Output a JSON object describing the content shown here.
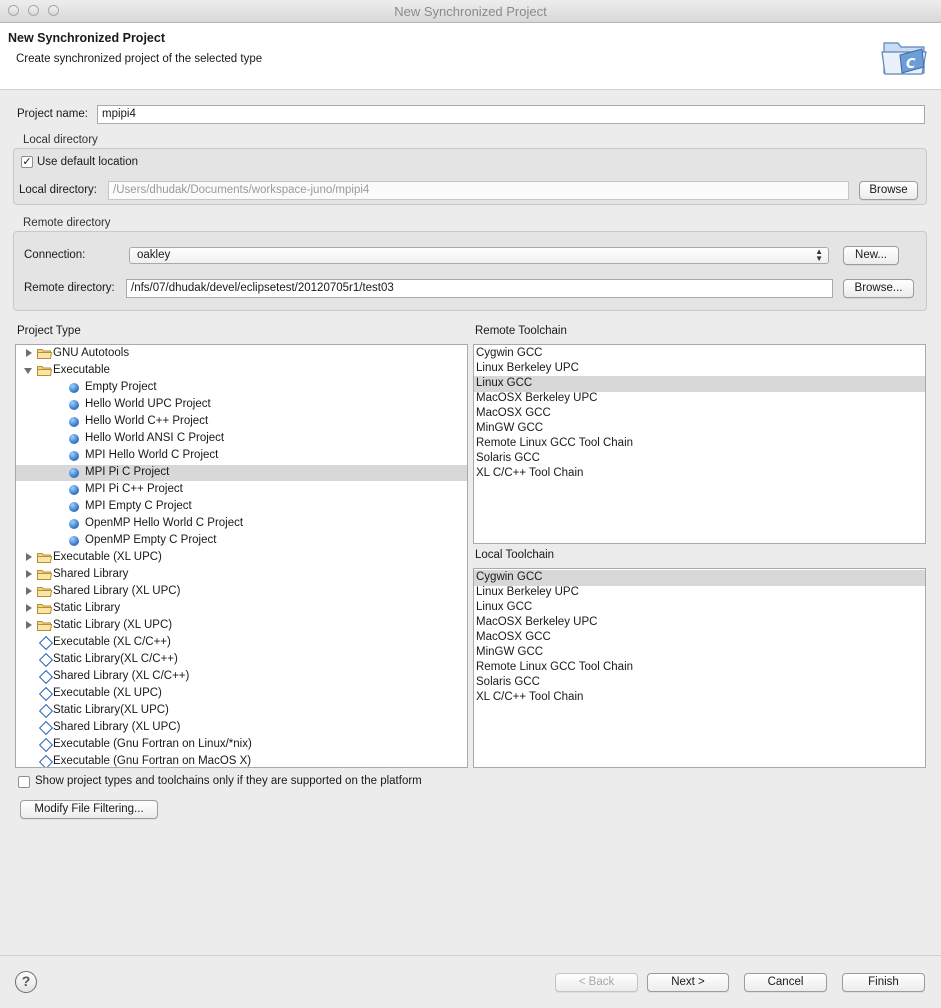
{
  "window": {
    "title": "New Synchronized Project"
  },
  "header": {
    "title": "New Synchronized Project",
    "description": "Create synchronized project of the selected type",
    "icon": "c-project-folder-icon"
  },
  "project_name": {
    "label": "Project name:",
    "value": "mpipi4"
  },
  "local_directory": {
    "group_label": "Local directory",
    "use_default_label": "Use default location",
    "use_default_checked": true,
    "field_label": "Local directory:",
    "value": "/Users/dhudak/Documents/workspace-juno/mpipi4",
    "browse_label": "Browse"
  },
  "remote_directory": {
    "group_label": "Remote directory",
    "connection_label": "Connection:",
    "connection_value": "oakley",
    "new_label": "New...",
    "field_label": "Remote directory:",
    "value": "/nfs/07/dhudak/devel/eclipsetest/20120705r1/test03",
    "browse_label": "Browse..."
  },
  "project_type": {
    "label": "Project Type",
    "items": [
      {
        "label": "GNU Autotools",
        "kind": "folder",
        "expander": "closed",
        "indent": 0
      },
      {
        "label": "Executable",
        "kind": "folder",
        "expander": "open",
        "indent": 0
      },
      {
        "label": "Empty Project",
        "kind": "dot",
        "indent": 1
      },
      {
        "label": "Hello World UPC Project",
        "kind": "dot",
        "indent": 1
      },
      {
        "label": "Hello World C++ Project",
        "kind": "dot",
        "indent": 1
      },
      {
        "label": "Hello World ANSI C Project",
        "kind": "dot",
        "indent": 1
      },
      {
        "label": "MPI Hello World C Project",
        "kind": "dot",
        "indent": 1
      },
      {
        "label": "MPI Pi C Project",
        "kind": "dot",
        "indent": 1,
        "selected": true
      },
      {
        "label": "MPI Pi C++ Project",
        "kind": "dot",
        "indent": 1
      },
      {
        "label": "MPI Empty C Project",
        "kind": "dot",
        "indent": 1
      },
      {
        "label": "OpenMP Hello World C Project",
        "kind": "dot",
        "indent": 1
      },
      {
        "label": "OpenMP Empty C Project",
        "kind": "dot",
        "indent": 1
      },
      {
        "label": "Executable (XL UPC)",
        "kind": "folder",
        "expander": "closed",
        "indent": 0
      },
      {
        "label": "Shared Library",
        "kind": "folder",
        "expander": "closed",
        "indent": 0
      },
      {
        "label": "Shared Library (XL UPC)",
        "kind": "folder",
        "expander": "closed",
        "indent": 0
      },
      {
        "label": "Static Library",
        "kind": "folder",
        "expander": "closed",
        "indent": 0
      },
      {
        "label": "Static Library (XL UPC)",
        "kind": "folder",
        "expander": "closed",
        "indent": 0
      },
      {
        "label": "Executable (XL C/C++)",
        "kind": "diamond",
        "indent": 0
      },
      {
        "label": "Static Library(XL C/C++)",
        "kind": "diamond",
        "indent": 0
      },
      {
        "label": "Shared Library (XL C/C++)",
        "kind": "diamond",
        "indent": 0
      },
      {
        "label": "Executable (XL UPC)",
        "kind": "diamond",
        "indent": 0
      },
      {
        "label": "Static Library(XL UPC)",
        "kind": "diamond",
        "indent": 0
      },
      {
        "label": "Shared Library (XL UPC)",
        "kind": "diamond",
        "indent": 0
      },
      {
        "label": "Executable (Gnu Fortran on Linux/*nix)",
        "kind": "diamond",
        "indent": 0
      },
      {
        "label": "Executable (Gnu Fortran on MacOS X)",
        "kind": "diamond",
        "indent": 0
      }
    ]
  },
  "remote_toolchain": {
    "label": "Remote Toolchain",
    "items": [
      "Cygwin GCC",
      "Linux Berkeley UPC",
      "Linux GCC",
      "MacOSX Berkeley UPC",
      "MacOSX GCC",
      "MinGW GCC",
      "Remote Linux GCC Tool Chain",
      "Solaris GCC",
      "XL C/C++ Tool Chain"
    ],
    "selected": "Linux GCC"
  },
  "local_toolchain": {
    "label": "Local Toolchain",
    "items": [
      "Cygwin GCC",
      "Linux Berkeley UPC",
      "Linux GCC",
      "MacOSX Berkeley UPC",
      "MacOSX GCC",
      "MinGW GCC",
      "Remote Linux GCC Tool Chain",
      "Solaris GCC",
      "XL C/C++ Tool Chain"
    ],
    "selected": "Cygwin GCC"
  },
  "show_supported": {
    "label": "Show project types and toolchains only if they are supported on the platform",
    "checked": false
  },
  "modify_filtering_label": "Modify File Filtering...",
  "footer": {
    "back_label": "< Back",
    "next_label": "Next >",
    "cancel_label": "Cancel",
    "finish_label": "Finish",
    "help_icon": "help-icon"
  }
}
